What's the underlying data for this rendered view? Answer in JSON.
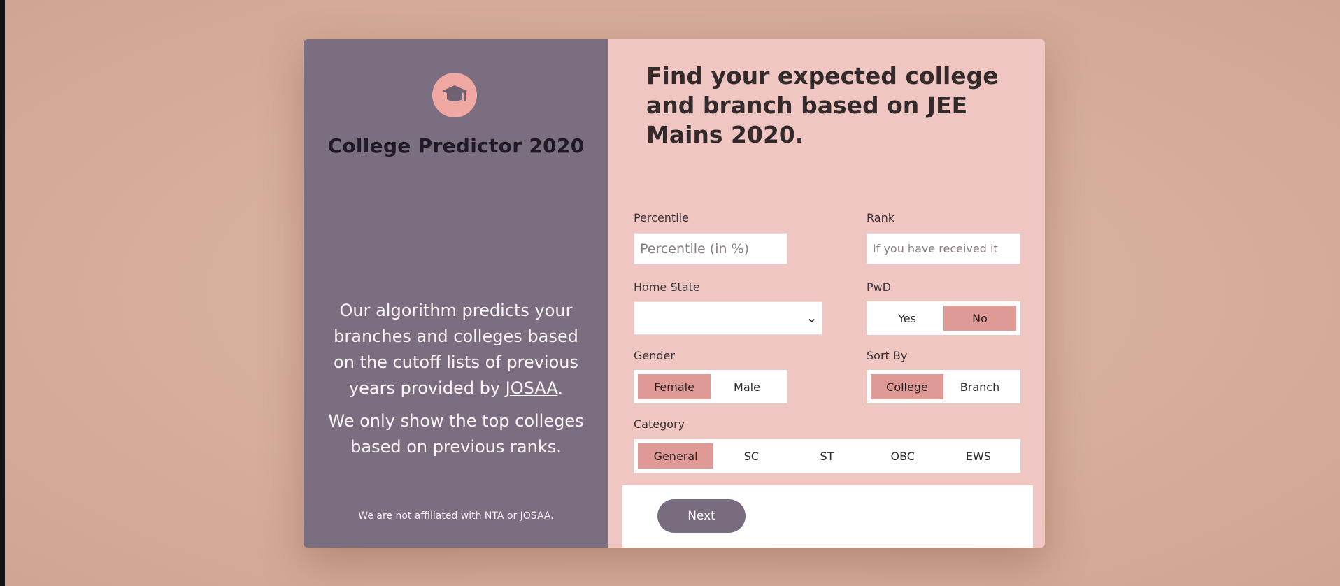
{
  "app": {
    "title": "College Predictor 2020",
    "logo_icon": "graduation-cap-icon"
  },
  "left_panel": {
    "description_1_pre": "Our algorithm predicts your branches and colleges based on the cutoff lists of previous years provided by ",
    "description_1_link": "JOSAA",
    "description_1_post": ".",
    "description_2": "We only show the top colleges based on previous ranks.",
    "disclaimer": "We are not affiliated with NTA or JOSAA."
  },
  "form": {
    "heading": "Find your expected college and branch based on JEE Mains 2020.",
    "percentile": {
      "label": "Percentile",
      "placeholder": "Percentile (in %)"
    },
    "rank": {
      "label": "Rank",
      "placeholder": "If you have received it"
    },
    "home_state": {
      "label": "Home State",
      "value": ""
    },
    "pwd": {
      "label": "PwD",
      "options": [
        "Yes",
        "No"
      ],
      "selected": "No"
    },
    "gender": {
      "label": "Gender",
      "options": [
        "Female",
        "Male"
      ],
      "selected": "Female"
    },
    "sort_by": {
      "label": "Sort By",
      "options": [
        "College",
        "Branch"
      ],
      "selected": "College"
    },
    "category": {
      "label": "Category",
      "options": [
        "General",
        "SC",
        "ST",
        "OBC",
        "EWS"
      ],
      "selected": "General"
    },
    "next_label": "Next"
  },
  "colors": {
    "page_bg": "#d9b19d",
    "left_panel": "#7b6e80",
    "right_panel": "#efc6c2",
    "accent": "#e09a96",
    "button": "#7a6c7f"
  }
}
